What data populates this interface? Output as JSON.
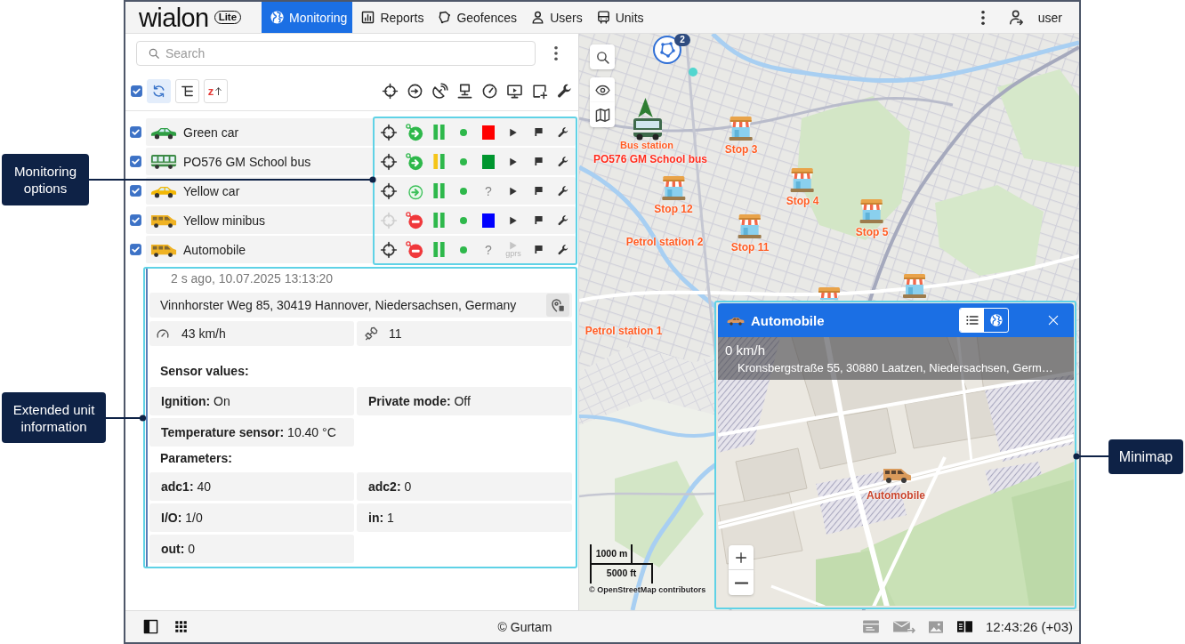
{
  "header": {
    "logo": {
      "name": "wialon",
      "edition": "Lite"
    },
    "tabs": [
      {
        "label": "Monitoring",
        "selected": true
      },
      {
        "label": "Reports",
        "selected": false
      },
      {
        "label": "Geofences",
        "selected": false
      },
      {
        "label": "Users",
        "selected": false
      },
      {
        "label": "Units",
        "selected": false
      }
    ],
    "user": "user"
  },
  "search": {
    "placeholder": "Search"
  },
  "toolbar": {
    "select_all": {
      "checked": true
    },
    "buttons": [
      {
        "selected": true
      },
      {
        "selected": false
      },
      {
        "selected": false,
        "label": "z"
      }
    ]
  },
  "units": [
    {
      "name": "Green car",
      "checked": true,
      "icon": {
        "kind": "car",
        "color": "#2f9e44"
      },
      "show_on_map": true,
      "moving": true,
      "ignition": true,
      "bars": [
        {
          "color": "#2eb84b"
        },
        {
          "color": "#2eb84b"
        }
      ],
      "connection": {
        "color": "#2eb84b"
      },
      "sensor": {
        "kind": "swatch",
        "color": "#ff0000"
      },
      "command": {
        "enabled": true
      }
    },
    {
      "name": "PO576 GM School bus",
      "checked": true,
      "icon": {
        "kind": "bus",
        "color": "#3c8a45"
      },
      "show_on_map": true,
      "moving": true,
      "ignition": true,
      "bars": [
        {
          "color": "#f5c518"
        },
        {
          "color": "#2eb84b"
        }
      ],
      "connection": {
        "color": "#2eb84b"
      },
      "sensor": {
        "kind": "swatch",
        "color": "#00962f"
      },
      "command": {
        "enabled": true
      }
    },
    {
      "name": "Yellow car",
      "checked": true,
      "icon": {
        "kind": "car",
        "color": "#f2b705"
      },
      "show_on_map": true,
      "moving": true,
      "ignition": false,
      "bars": [
        {
          "color": "#2eb84b"
        },
        {
          "color": "#2eb84b"
        }
      ],
      "connection": {
        "color": "#2eb84b"
      },
      "sensor": {
        "kind": "unknown",
        "text": "?"
      },
      "command": {
        "enabled": true
      }
    },
    {
      "name": "Yellow minibus",
      "checked": true,
      "icon": {
        "kind": "van",
        "color": "#f0b323"
      },
      "show_on_map": false,
      "moving": false,
      "ignition": true,
      "bars": [
        {
          "color": "#2eb84b"
        },
        {
          "color": "#2eb84b"
        }
      ],
      "connection": {
        "color": "#2eb84b"
      },
      "sensor": {
        "kind": "swatch",
        "color": "#0000ff"
      },
      "command": {
        "enabled": true
      }
    },
    {
      "name": "Automobile",
      "checked": true,
      "icon": {
        "kind": "van",
        "color": "#f0b323"
      },
      "show_on_map": true,
      "moving": false,
      "ignition": true,
      "bars": [
        {
          "color": "#2eb84b"
        },
        {
          "color": "#2eb84b"
        }
      ],
      "connection": {
        "color": "#2eb84b"
      },
      "sensor": {
        "kind": "unknown",
        "text": "?"
      },
      "command": {
        "enabled": false,
        "label": "gprs"
      }
    }
  ],
  "unit_info": {
    "time": "2 s ago, 10.07.2025 13:13:20",
    "address": "Vinnhorster Weg 85, 30419 Hannover, Niedersachsen, Germany",
    "speed": "43 km/h",
    "satellites": "11",
    "sensors_title": "Sensor values:",
    "sensors": [
      "**Ignition:** On",
      "**Private mode:** Off",
      "**Temperature sensor:** 10.40 °C"
    ],
    "parameters_title": "Parameters:",
    "parameters": [
      "**adc1:** 40",
      "**adc2:** 0",
      "**I/O:** 1/0",
      "**in:** 1",
      "**out:** 0"
    ]
  },
  "map": {
    "cluster": {
      "count": "2"
    },
    "unit": {
      "label": "PO576 GM School bus"
    },
    "geofences": [
      {
        "kind": "stop",
        "label": "Stop 3"
      },
      {
        "kind": "label",
        "label": "Bus station"
      },
      {
        "kind": "stop",
        "label": "Stop 4"
      },
      {
        "kind": "stop",
        "label": "Stop 12"
      },
      {
        "kind": "stop",
        "label": "Stop 5"
      },
      {
        "kind": "stop",
        "label": "Stop 11"
      },
      {
        "kind": "label",
        "label": "Petrol station 2"
      },
      {
        "kind": "stop"
      },
      {
        "kind": "stop"
      },
      {
        "kind": "label",
        "label": "Petrol station 1"
      }
    ],
    "scale": [
      "1000 m",
      "5000 ft"
    ],
    "attribution": "© OpenStreetMap contributors"
  },
  "minimap": {
    "title": "Automobile",
    "views": [
      {
        "selected": true
      },
      {
        "selected": false
      }
    ],
    "speed": "0 km/h",
    "address": "Kronsbergstraße 55, 30880 Laatzen, Niedersachsen, Germ…",
    "unit_label": "Automobile"
  },
  "footer": {
    "copyright": "© Gurtam",
    "time": "12:43:26 (+03)"
  },
  "callouts": [
    {
      "text": "Monitoring options"
    },
    {
      "text": "Extended unit information"
    },
    {
      "text": "Minimap"
    }
  ]
}
